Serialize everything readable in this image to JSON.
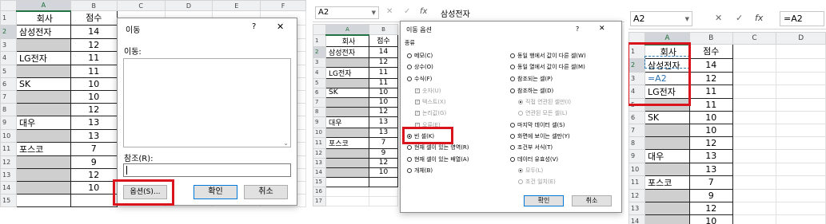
{
  "panel1": {
    "columns": [
      "A",
      "B",
      "C",
      "D",
      "E",
      "F"
    ],
    "rows": [
      {
        "n": "1",
        "a": "회사",
        "b": "점수"
      },
      {
        "n": "2",
        "a": "삼성전자",
        "b": "14"
      },
      {
        "n": "3",
        "a": "",
        "b": "12"
      },
      {
        "n": "4",
        "a": "LG전자",
        "b": "11"
      },
      {
        "n": "5",
        "a": "",
        "b": "11"
      },
      {
        "n": "6",
        "a": "SK",
        "b": "10"
      },
      {
        "n": "7",
        "a": "",
        "b": "10"
      },
      {
        "n": "8",
        "a": "",
        "b": "12"
      },
      {
        "n": "9",
        "a": "대우",
        "b": "13"
      },
      {
        "n": "10",
        "a": "",
        "b": "13"
      },
      {
        "n": "11",
        "a": "포스코",
        "b": "7"
      },
      {
        "n": "12",
        "a": "",
        "b": "9"
      },
      {
        "n": "13",
        "a": "",
        "b": "12"
      },
      {
        "n": "14",
        "a": "",
        "b": "10"
      },
      {
        "n": "15",
        "a": "",
        "b": ""
      }
    ],
    "dialog": {
      "title": "이동",
      "help": "?",
      "close": "✕",
      "goto_label": "이동:",
      "reference_label": "참조(R):",
      "reference_value": "",
      "options_button": "옵션(S)...",
      "ok_button": "확인",
      "cancel_button": "취소"
    }
  },
  "panel2": {
    "name_box": "A2",
    "formula_icon": "fx",
    "formula_value": "삼성전자",
    "columns": [
      "A",
      "B"
    ],
    "rows": [
      {
        "n": "1",
        "a": "회사",
        "b": "점수"
      },
      {
        "n": "2",
        "a": "삼성전자",
        "b": "14"
      },
      {
        "n": "3",
        "a": "",
        "b": "12"
      },
      {
        "n": "4",
        "a": "LG전자",
        "b": "11"
      },
      {
        "n": "5",
        "a": "",
        "b": "11"
      },
      {
        "n": "6",
        "a": "SK",
        "b": "10"
      },
      {
        "n": "7",
        "a": "",
        "b": "10"
      },
      {
        "n": "8",
        "a": "",
        "b": "12"
      },
      {
        "n": "9",
        "a": "대우",
        "b": "13"
      },
      {
        "n": "10",
        "a": "",
        "b": "13"
      },
      {
        "n": "11",
        "a": "포스코",
        "b": "7"
      },
      {
        "n": "12",
        "a": "",
        "b": "9"
      },
      {
        "n": "13",
        "a": "",
        "b": "12"
      },
      {
        "n": "14",
        "a": "",
        "b": "10"
      },
      {
        "n": "15",
        "a": "",
        "b": ""
      },
      {
        "n": "16",
        "a": "",
        "b": ""
      },
      {
        "n": "17",
        "a": "",
        "b": ""
      }
    ],
    "dialog": {
      "title": "이동 옵션",
      "help": "?",
      "close": "✕",
      "group_label": "종류",
      "left_options": [
        {
          "label": "메모(C)",
          "kind": "radio",
          "on": false,
          "disabled": false
        },
        {
          "label": "상수(O)",
          "kind": "radio",
          "on": false,
          "disabled": false
        },
        {
          "label": "수식(F)",
          "kind": "radio",
          "on": false,
          "disabled": false
        },
        {
          "label": "숫자(U)",
          "kind": "check",
          "on": true,
          "disabled": true
        },
        {
          "label": "텍스트(X)",
          "kind": "check",
          "on": true,
          "disabled": true
        },
        {
          "label": "논리값(G)",
          "kind": "check",
          "on": true,
          "disabled": true
        },
        {
          "label": "오류(E)",
          "kind": "check",
          "on": true,
          "disabled": true
        },
        {
          "label": "빈 셀(K)",
          "kind": "radio",
          "on": true,
          "disabled": false
        },
        {
          "label": "현재 셀이 있는 영역(R)",
          "kind": "radio",
          "on": false,
          "disabled": false
        },
        {
          "label": "현재 셀이 있는 배열(A)",
          "kind": "radio",
          "on": false,
          "disabled": false
        },
        {
          "label": "개체(B)",
          "kind": "radio",
          "on": false,
          "disabled": false
        }
      ],
      "right_options": [
        {
          "label": "동일 행에서 값이 다른 셀(W)",
          "kind": "radio",
          "on": false,
          "disabled": false
        },
        {
          "label": "동일 열에서 값이 다른 셀(M)",
          "kind": "radio",
          "on": false,
          "disabled": false
        },
        {
          "label": "참조되는 셀(P)",
          "kind": "radio",
          "on": false,
          "disabled": false
        },
        {
          "label": "참조하는 셀(D)",
          "kind": "radio",
          "on": false,
          "disabled": false
        },
        {
          "label": "직접 연관된 셀만(I)",
          "kind": "radio",
          "on": true,
          "disabled": true
        },
        {
          "label": "연관된 모든 셀(L)",
          "kind": "radio",
          "on": false,
          "disabled": true
        },
        {
          "label": "마지막 데이터 셀(S)",
          "kind": "radio",
          "on": false,
          "disabled": false
        },
        {
          "label": "화면에 보이는 셀만(Y)",
          "kind": "radio",
          "on": false,
          "disabled": false
        },
        {
          "label": "조건부 서식(T)",
          "kind": "radio",
          "on": false,
          "disabled": false
        },
        {
          "label": "데이터 유효성(V)",
          "kind": "radio",
          "on": false,
          "disabled": false
        },
        {
          "label": "모두(L)",
          "kind": "radio",
          "on": true,
          "disabled": true
        },
        {
          "label": "조건 일치(E)",
          "kind": "radio",
          "on": false,
          "disabled": true
        }
      ],
      "ok_button": "확인",
      "cancel_button": "취소"
    }
  },
  "panel3": {
    "name_box": "A2",
    "formula_icon": "fx",
    "formula_value": "=A2",
    "columns": [
      "A",
      "B",
      "C",
      "D"
    ],
    "rows": [
      {
        "n": "1",
        "a": "회사",
        "b": "점수"
      },
      {
        "n": "2",
        "a": "삼성전자",
        "b": "14"
      },
      {
        "n": "3",
        "a": "=A2",
        "b": "12"
      },
      {
        "n": "4",
        "a": "LG전자",
        "b": "11"
      },
      {
        "n": "5",
        "a": "",
        "b": "11"
      },
      {
        "n": "6",
        "a": "SK",
        "b": "10"
      },
      {
        "n": "7",
        "a": "",
        "b": "10"
      },
      {
        "n": "8",
        "a": "",
        "b": "12"
      },
      {
        "n": "9",
        "a": "대우",
        "b": "13"
      },
      {
        "n": "10",
        "a": "",
        "b": "13"
      },
      {
        "n": "11",
        "a": "포스코",
        "b": "7"
      },
      {
        "n": "12",
        "a": "",
        "b": "9"
      },
      {
        "n": "13",
        "a": "",
        "b": "12"
      },
      {
        "n": "14",
        "a": "",
        "b": "10"
      }
    ]
  },
  "colors": {
    "highlight_red": "#d9141c",
    "excel_green": "#217346",
    "blank_cell_gray": "#cfcfcf"
  }
}
